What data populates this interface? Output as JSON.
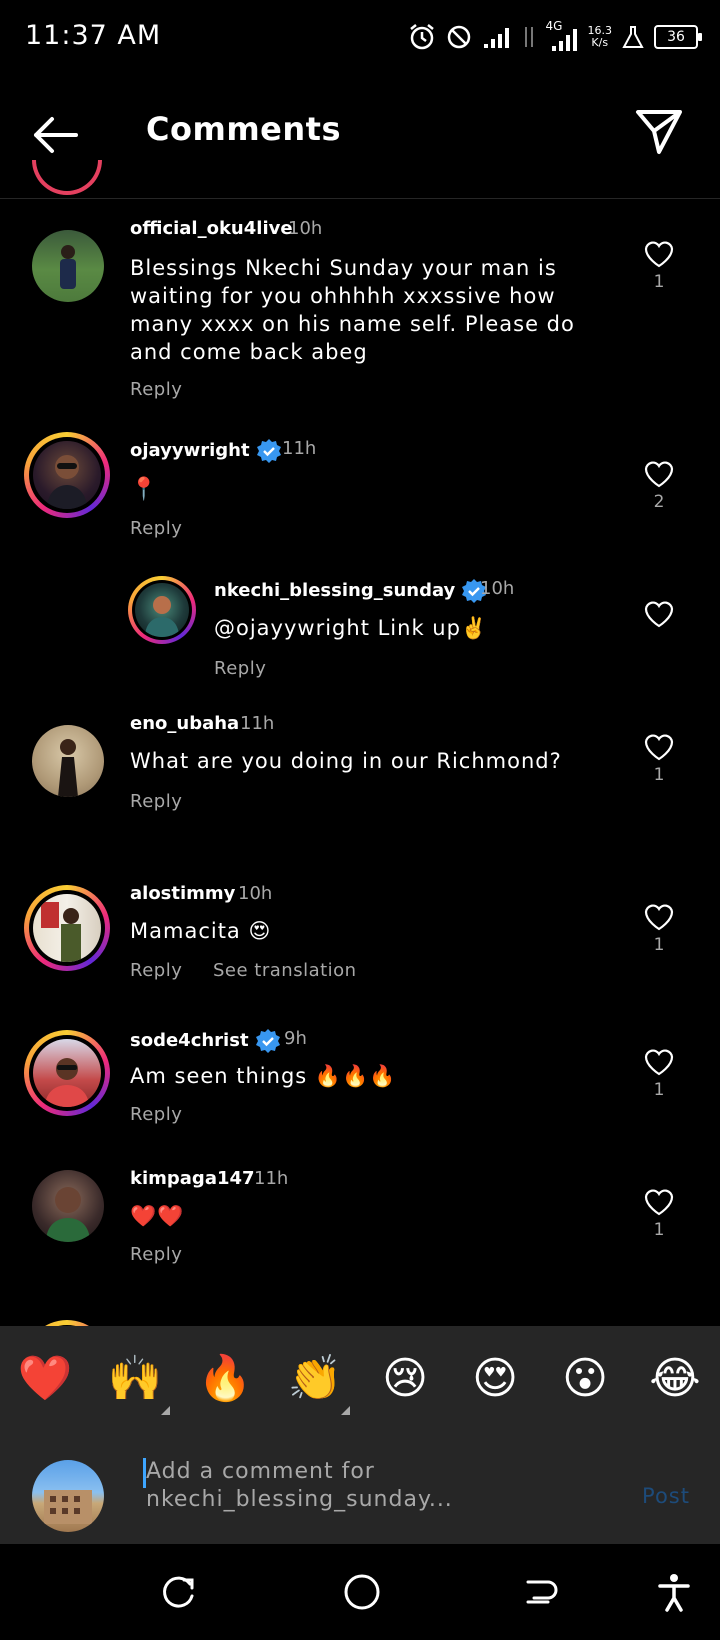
{
  "status_bar": {
    "time": "11:37 AM",
    "network_type": "4G",
    "speed_value": "16.3",
    "speed_unit": "K/s",
    "battery": "36"
  },
  "header": {
    "title": "Comments",
    "back_icon": "arrow-left-icon",
    "share_icon": "paper-plane-icon"
  },
  "comments": [
    {
      "username": "official_oku4live",
      "time": "10h",
      "verified": false,
      "story_ring": false,
      "text": "Blessings Nkechi Sunday your man is waiting for you ohhhhh xxxssive how many xxxx on his name self.  Please do and come back abeg",
      "reply": "Reply",
      "likes": "1"
    },
    {
      "username": "ojayywright",
      "time": "11h",
      "verified": true,
      "story_ring": true,
      "text": "📍",
      "reply": "Reply",
      "likes": "2"
    },
    {
      "username": "nkechi_blessing_sunday",
      "time": "10h",
      "verified": true,
      "story_ring": true,
      "is_reply": true,
      "text": "@ojayywright Link up✌️",
      "reply": "Reply",
      "likes": ""
    },
    {
      "username": "eno_ubaha",
      "time": "11h",
      "verified": false,
      "story_ring": false,
      "text": "What are you doing in our Richmond?",
      "reply": "Reply",
      "likes": "1"
    },
    {
      "username": "alostimmy",
      "time": "10h",
      "verified": false,
      "story_ring": true,
      "text": "Mamacita 😍",
      "reply": "Reply",
      "see_translation": "See translation",
      "likes": "1"
    },
    {
      "username": "sode4christ",
      "time": "9h",
      "verified": true,
      "story_ring": true,
      "text": "Am seen things 🔥🔥🔥",
      "reply": "Reply",
      "likes": "1"
    },
    {
      "username": "kimpaga147",
      "time": "11h",
      "verified": false,
      "story_ring": false,
      "text": "❤️❤️",
      "reply": "Reply",
      "likes": "1"
    }
  ],
  "emoji_bar": [
    "❤️",
    "🙌",
    "🔥",
    "👏",
    "😢",
    "😍",
    "😮",
    "😂"
  ],
  "composer": {
    "placeholder": "Add a comment for nkechi_blessing_sunday...",
    "post_label": "Post"
  },
  "navbar": [
    "recents-icon",
    "home-circle-icon",
    "back-icon",
    "accessibility-icon"
  ],
  "colors": {
    "background": "#000000",
    "secondary_text": "#a8a8a8",
    "verified_blue": "#3897f0",
    "post_disabled": "#1d4b7a",
    "composer_bg": "#262626"
  }
}
